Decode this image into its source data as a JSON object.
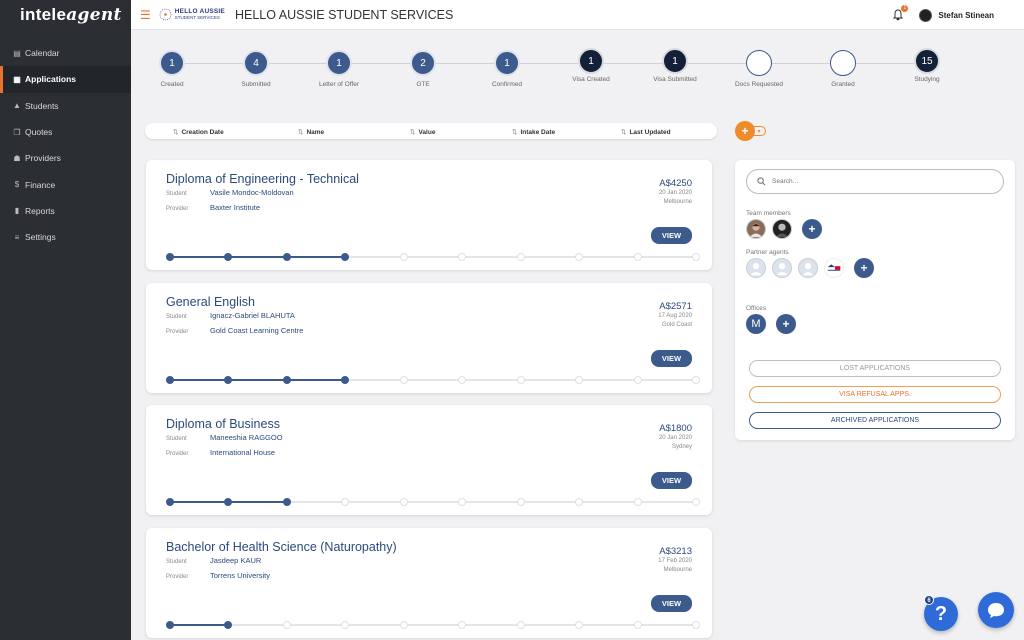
{
  "app": {
    "logo_prefix": "intele",
    "logo_suffix": "agent"
  },
  "sidebar": {
    "items": [
      {
        "label": "Calendar",
        "icon": "calendar-icon",
        "active": false
      },
      {
        "label": "Applications",
        "icon": "grid-icon",
        "active": true
      },
      {
        "label": "Students",
        "icon": "graduation-cap-icon",
        "active": false
      },
      {
        "label": "Quotes",
        "icon": "quotes-icon",
        "active": false
      },
      {
        "label": "Providers",
        "icon": "building-icon",
        "active": false
      },
      {
        "label": "Finance",
        "icon": "dollar-icon",
        "active": false
      },
      {
        "label": "Reports",
        "icon": "bar-chart-icon",
        "active": false
      },
      {
        "label": "Settings",
        "icon": "sliders-icon",
        "active": false
      }
    ]
  },
  "header": {
    "brand_line1": "HELLO AUSSIE",
    "brand_line2": "STUDENT SERVICES",
    "title": "HELLO AUSSIE STUDENT SERVICES",
    "notification_count": "1",
    "user_name": "Stefan Stinean"
  },
  "stages": [
    {
      "label": "Created",
      "count": "1",
      "style": "mid"
    },
    {
      "label": "Submitted",
      "count": "4",
      "style": "mid"
    },
    {
      "label": "Letter of Offer",
      "count": "1",
      "style": "mid"
    },
    {
      "label": "GTE",
      "count": "2",
      "style": "mid"
    },
    {
      "label": "Confirmed",
      "count": "1",
      "style": "mid"
    },
    {
      "label": "Visa Created",
      "count": "1",
      "style": "dark"
    },
    {
      "label": "Visa Submitted",
      "count": "1",
      "style": "dark"
    },
    {
      "label": "Docs Requested",
      "count": "",
      "style": "empty"
    },
    {
      "label": "Granted",
      "count": "",
      "style": "empty"
    },
    {
      "label": "Studying",
      "count": "15",
      "style": "dark"
    }
  ],
  "sort": {
    "creation_date": "Creation Date",
    "name": "Name",
    "value": "Value",
    "intake_date": "Intake Date",
    "last_updated": "Last Updated"
  },
  "add_button": "+",
  "labels": {
    "student": "Student",
    "provider": "Provider",
    "view": "VIEW"
  },
  "applications": [
    {
      "course": "Diploma of Engineering - Technical",
      "student": "Vasile Mondoc-Moldovan",
      "provider": "Baxter Institute",
      "price": "A$4250",
      "date": "20 Jan 2020",
      "location": "Melbourne",
      "progress": 4,
      "steps": 10
    },
    {
      "course": "General English",
      "student": "Ignacz-Gabriel BLAHUTA",
      "provider": "Gold Coast Learning Centre",
      "price": "A$2571",
      "date": "17 Aug 2020",
      "location": "Gold Coast",
      "progress": 4,
      "steps": 10
    },
    {
      "course": "Diploma of Business",
      "student": "Maneeshia RAGGOO",
      "provider": "International House",
      "price": "A$1800",
      "date": "20 Jan 2020",
      "location": "Sydney",
      "progress": 3,
      "steps": 10
    },
    {
      "course": "Bachelor of Health Science (Naturopathy)",
      "student": "Jasdeep KAUR",
      "provider": "Torrens University",
      "price": "A$3213",
      "date": "17 Feb 2020",
      "location": "Melbourne",
      "progress": 2,
      "steps": 10
    }
  ],
  "panel": {
    "search_placeholder": "Search...",
    "team_members_label": "Team members",
    "partner_agents_label": "Partner agents",
    "offices_label": "Offices",
    "office_initial": "M",
    "lost_label": "LOST APPLICATIONS",
    "refusal_label": "VISA REFUSAL APPS.",
    "archived_label": "ARCHIVED APPLICATIONS"
  },
  "help": {
    "label": "?",
    "badge": "6"
  },
  "colors": {
    "accent": "#e8732a",
    "primary": "#3d5a8c",
    "sidebar": "#2b2e33"
  }
}
